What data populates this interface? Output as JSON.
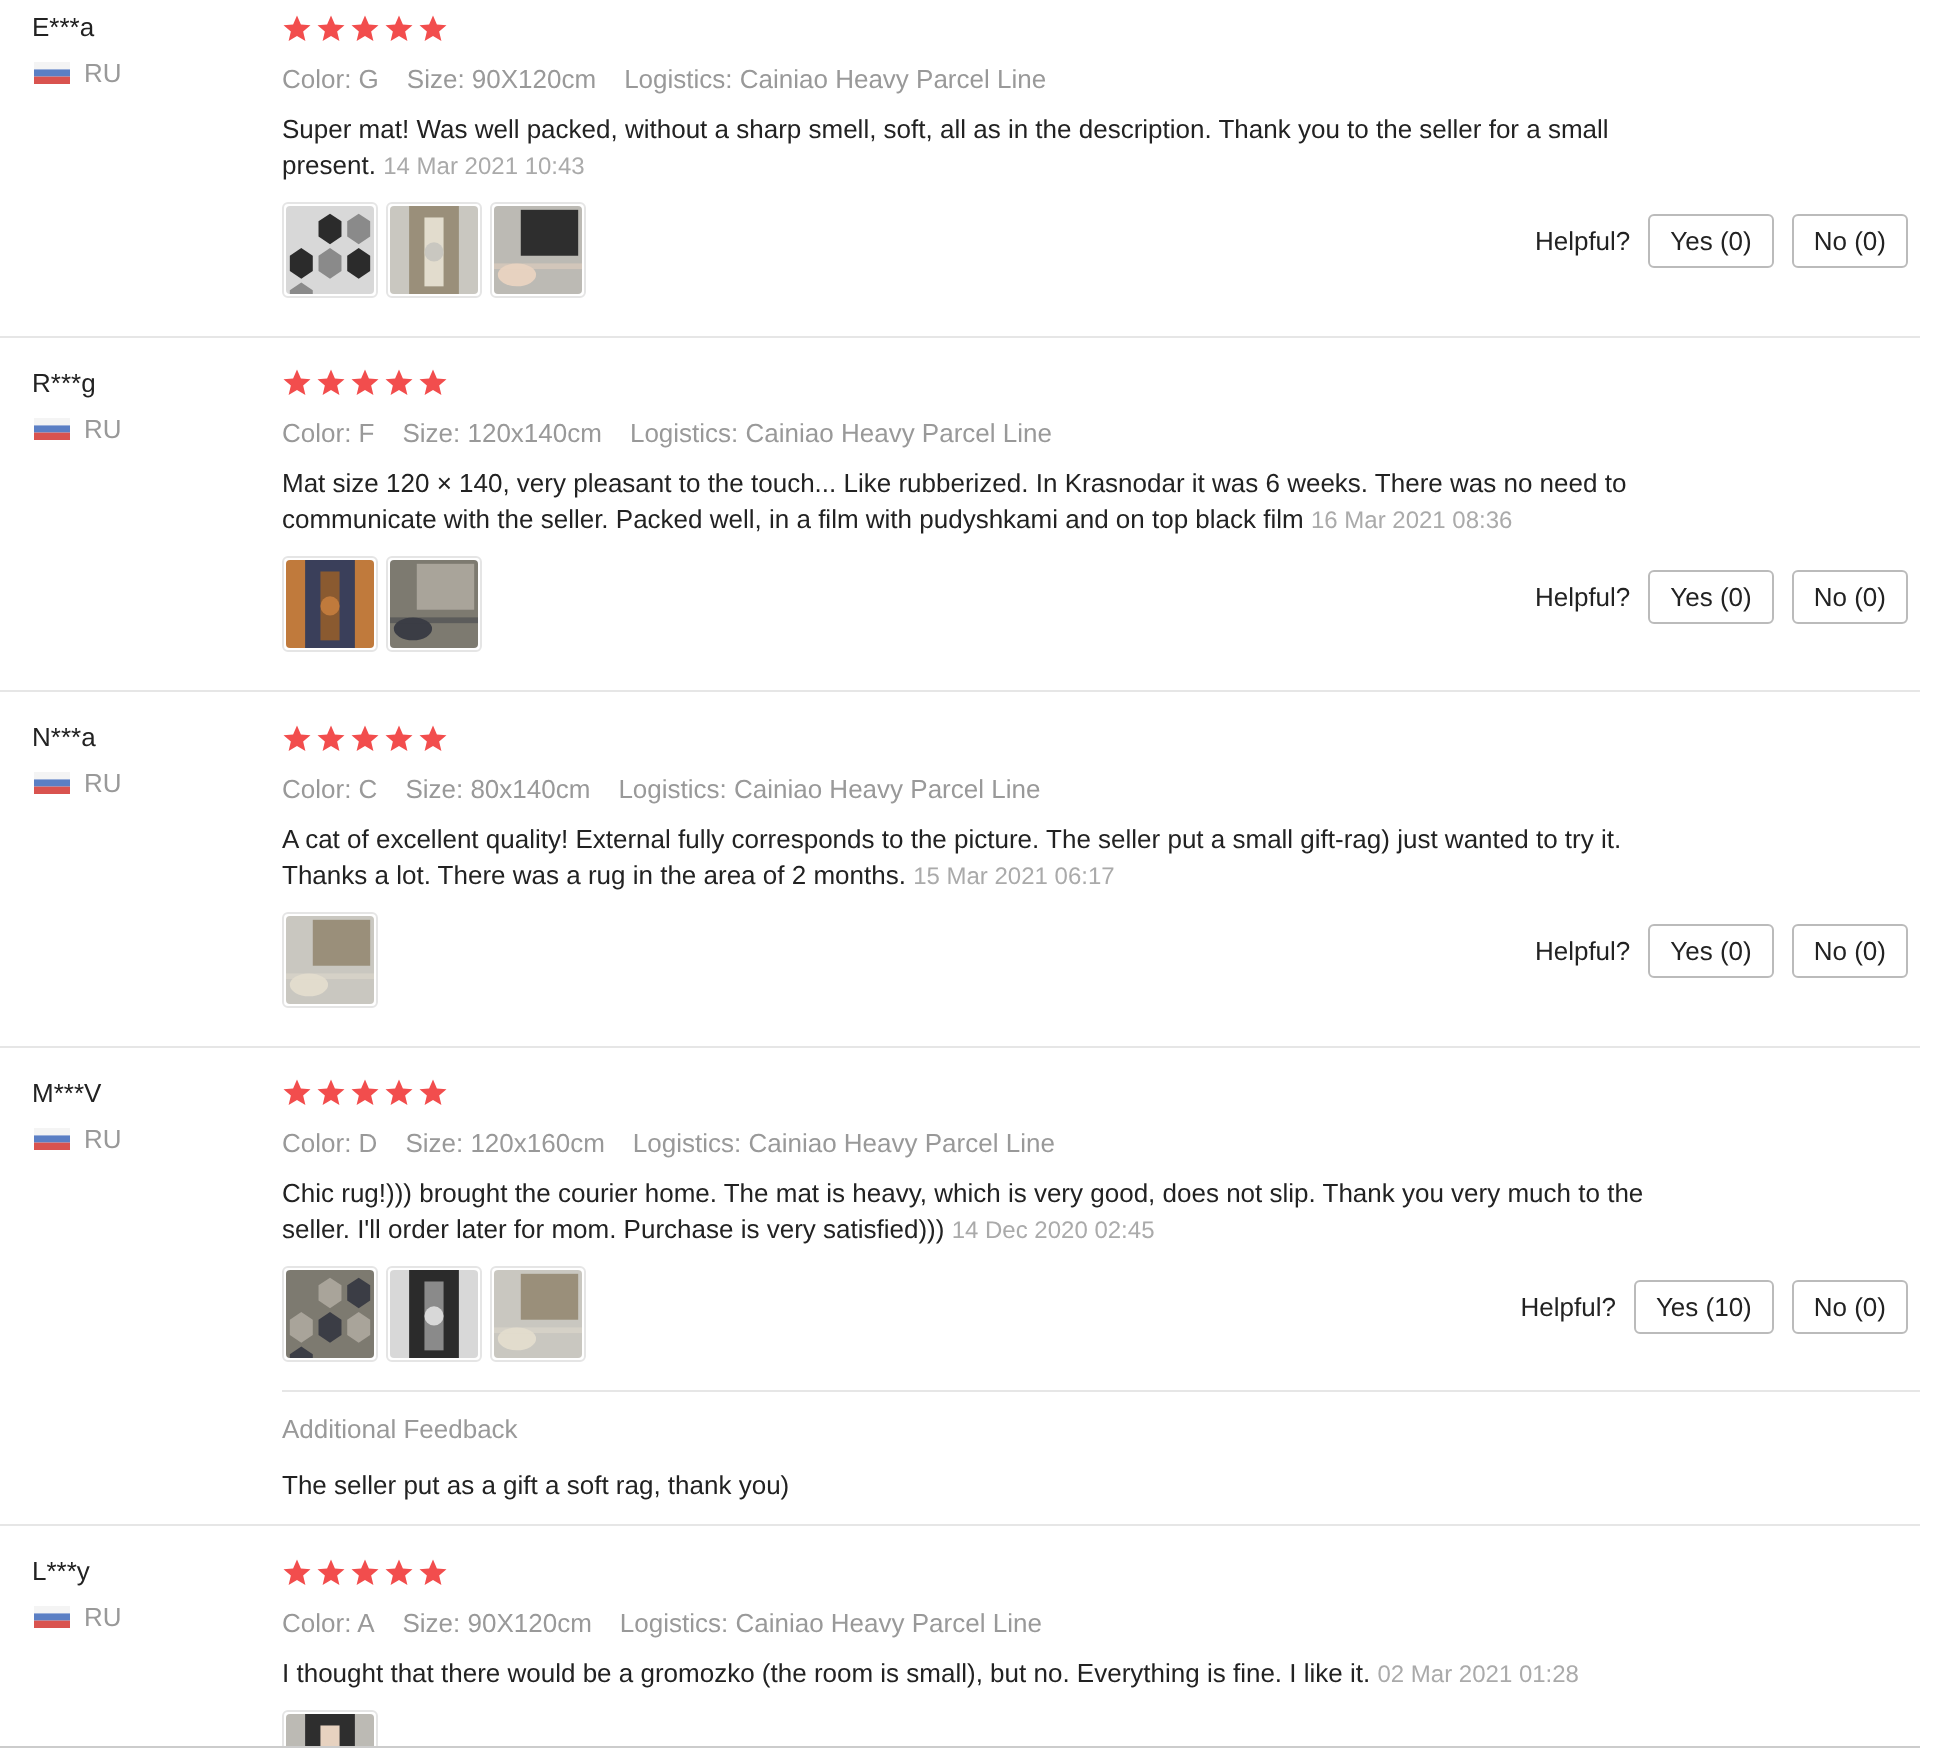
{
  "reviews": [
    {
      "user": "E***a",
      "country": "RU",
      "stars": 5,
      "color_option": "Color: G",
      "size": "Size: 90X120cm",
      "logistics": "Logistics: Cainiao Heavy Parcel Line",
      "text": "Super mat! Was well packed, without a sharp smell, soft, all as in the description. Thank you to the seller for a small present.",
      "date": "14 Mar 2021 10:43",
      "photos": [
        {
          "kind": "picture"
        },
        {
          "kind": "picture"
        },
        {
          "kind": "picture"
        }
      ],
      "helpful_label": "Helpful?",
      "yes": "Yes (0)",
      "no": "No (0)"
    },
    {
      "user": "R***g",
      "country": "RU",
      "stars": 5,
      "color_option": "Color: F",
      "size": "Size: 120x140cm",
      "logistics": "Logistics: Cainiao Heavy Parcel Line",
      "text": "Mat size 120 × 140, very pleasant to the touch... Like rubberized. In Krasnodar it was 6 weeks. There was no need to communicate with the seller. Packed well, in a film with pudyshkami and on top black film",
      "date": "16 Mar 2021 08:36",
      "photos": [
        {
          "kind": "picture"
        },
        {
          "kind": "picture"
        }
      ],
      "helpful_label": "Helpful?",
      "yes": "Yes (0)",
      "no": "No (0)"
    },
    {
      "user": "N***a",
      "country": "RU",
      "stars": 5,
      "color_option": "Color: C",
      "size": "Size: 80x140cm",
      "logistics": "Logistics: Cainiao Heavy Parcel Line",
      "text": "A cat of excellent quality! External fully corresponds to the picture. The seller put a small gift-rag) just wanted to try it. Thanks a lot. There was a rug in the area of 2 months.",
      "date": "15 Mar 2021 06:17",
      "photos": [
        {
          "kind": "picture"
        }
      ],
      "helpful_label": "Helpful?",
      "yes": "Yes (0)",
      "no": "No (0)"
    },
    {
      "user": "M***V",
      "country": "RU",
      "stars": 5,
      "color_option": "Color: D",
      "size": "Size: 120x160cm",
      "logistics": "Logistics: Cainiao Heavy Parcel Line",
      "text": "Chic rug!))) brought the courier home. The mat is heavy, which is very good, does not slip. Thank you very much to the seller. I'll order later for mom. Purchase is very satisfied)))",
      "date": "14 Dec 2020 02:45",
      "photos": [
        {
          "kind": "picture"
        },
        {
          "kind": "picture"
        },
        {
          "kind": "picture"
        }
      ],
      "helpful_label": "Helpful?",
      "yes": "Yes (10)",
      "no": "No (0)",
      "additional": {
        "label": "Additional Feedback",
        "text": "The seller put as a gift a soft rag, thank you)"
      }
    },
    {
      "user": "L***y",
      "country": "RU",
      "stars": 5,
      "color_option": "Color: A",
      "size": "Size: 90X120cm",
      "logistics": "Logistics: Cainiao Heavy Parcel Line",
      "text": "I thought that there would be a gromozko (the room is small), but no. Everything is fine. I like it.",
      "date": "02 Mar 2021 01:28",
      "photos": [
        {
          "kind": "picture"
        }
      ]
    }
  ]
}
